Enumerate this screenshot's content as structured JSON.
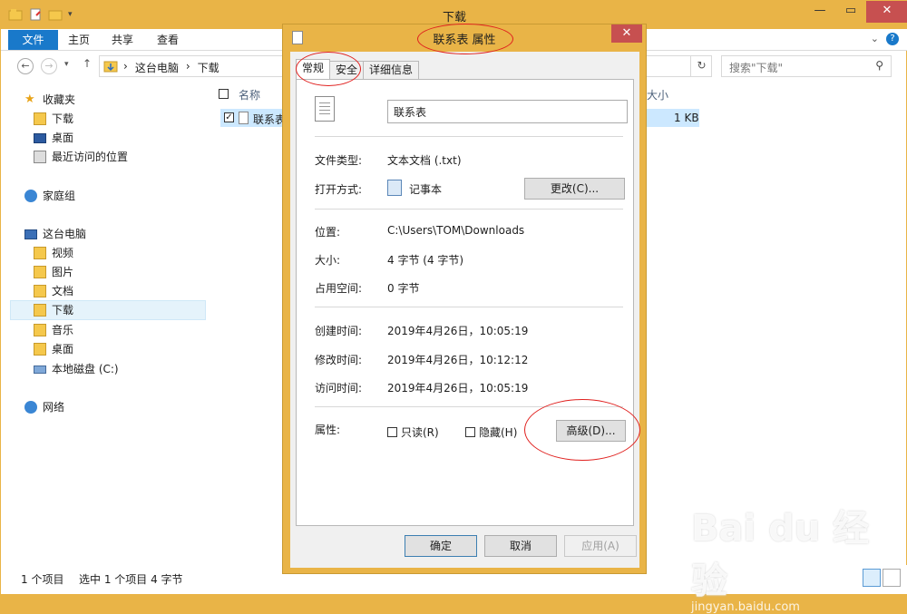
{
  "explorer": {
    "title": "下载",
    "ribbon_tabs": [
      "文件",
      "主页",
      "共享",
      "查看"
    ],
    "help": "?",
    "breadcrumbs": [
      "这台电脑",
      "下载"
    ],
    "search_placeholder": "搜索\"下载\"",
    "nav": {
      "favorites": "收藏夹",
      "downloads": "下载",
      "desktop": "桌面",
      "recent": "最近访问的位置",
      "homegroup": "家庭组",
      "this_pc": "这台电脑",
      "videos": "视频",
      "pictures": "图片",
      "documents": "文档",
      "downloads2": "下载",
      "music": "音乐",
      "desktop2": "桌面",
      "local_disk": "本地磁盘 (C:)",
      "network": "网络"
    },
    "columns": {
      "name": "名称",
      "size": "大小"
    },
    "file": {
      "name": "联系表",
      "size": "1 KB"
    },
    "status": {
      "count": "1 个项目",
      "selected": "选中 1 个项目  4 字节"
    }
  },
  "dialog": {
    "title": "联系表 属性",
    "close": "✕",
    "tabs": [
      "常规",
      "安全",
      "详细信息"
    ],
    "name_value": "联系表",
    "type_label": "文件类型:",
    "type_value": "文本文档 (.txt)",
    "open_label": "打开方式:",
    "open_value": "记事本",
    "change_button": "更改(C)...",
    "location_label": "位置:",
    "location_value": "C:\\Users\\TOM\\Downloads",
    "size_label": "大小:",
    "size_value": "4 字节 (4 字节)",
    "disk_label": "占用空间:",
    "disk_value": "0 字节",
    "created_label": "创建时间:",
    "created_value": "2019年4月26日，10:05:19",
    "modified_label": "修改时间:",
    "modified_value": "2019年4月26日，10:12:12",
    "accessed_label": "访问时间:",
    "accessed_value": "2019年4月26日，10:05:19",
    "attr_label": "属性:",
    "readonly": "只读(R)",
    "hidden": "隐藏(H)",
    "advanced_button": "高级(D)...",
    "ok": "确定",
    "cancel": "取消",
    "apply": "应用(A)"
  },
  "watermark": {
    "brand": "Bai du 经验",
    "url": "jingyan.baidu.com"
  },
  "colors": {
    "accent": "#e9b447",
    "ribbon_blue": "#1979ca",
    "annotation_red": "#e0201e",
    "close_red": "#c75050"
  }
}
